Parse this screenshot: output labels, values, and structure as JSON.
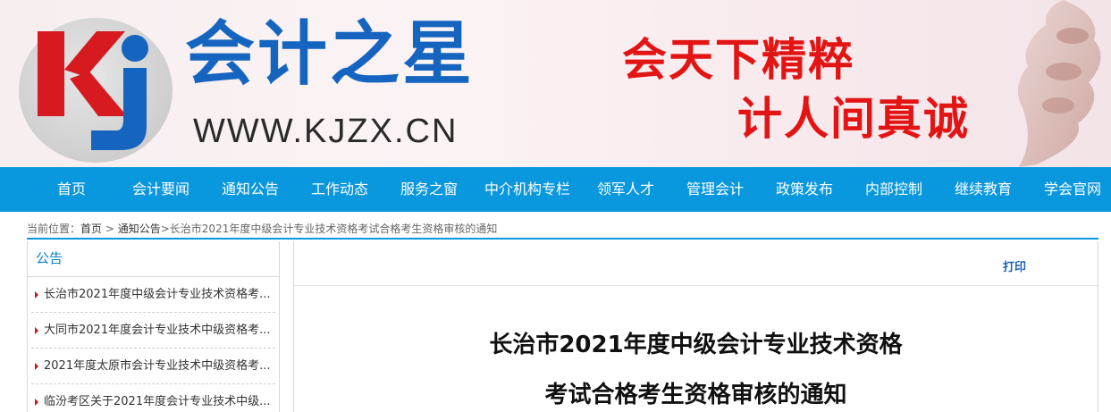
{
  "banner": {
    "logo_text": "Kj",
    "brand_cn": "会计之星",
    "brand_url": "WWW.KJZX.CN",
    "slogan_line1": "会天下精粹",
    "slogan_line2": "计人间真诚"
  },
  "nav": {
    "items": [
      {
        "label": "首页"
      },
      {
        "label": "会计要闻"
      },
      {
        "label": "通知公告"
      },
      {
        "label": "工作动态"
      },
      {
        "label": "服务之窗"
      },
      {
        "label": "中介机构专栏"
      },
      {
        "label": "领军人才"
      },
      {
        "label": "管理会计"
      },
      {
        "label": "政策发布"
      },
      {
        "label": "内部控制"
      },
      {
        "label": "继续教育"
      },
      {
        "label": "学会官网"
      }
    ]
  },
  "breadcrumb": {
    "prefix": "当前位置：",
    "home": "首页",
    "sep": " > ",
    "section": "通知公告",
    "sep2": ">",
    "current": "长治市2021年度中级会计专业技术资格考试合格考生资格审核的通知"
  },
  "sidebar": {
    "title": "公告",
    "items": [
      {
        "label": "长治市2021年度中级会计专业技术资格考..."
      },
      {
        "label": "大同市2021年度会计专业技术中级资格考..."
      },
      {
        "label": "2021年度太原市会计专业技术中级资格考..."
      },
      {
        "label": "临汾考区关于2021年度会计专业技术中级..."
      }
    ]
  },
  "article": {
    "print_label": "打印",
    "title_line1": "长治市2021年度中级会计专业技术资格",
    "title_line2": "考试合格考生资格审核的通知"
  },
  "colors": {
    "nav_bg": "#0997de",
    "brand_blue": "#1565c0",
    "slogan_red": "#e31414",
    "logo_red": "#d71920",
    "logo_blue": "#1565c0"
  }
}
